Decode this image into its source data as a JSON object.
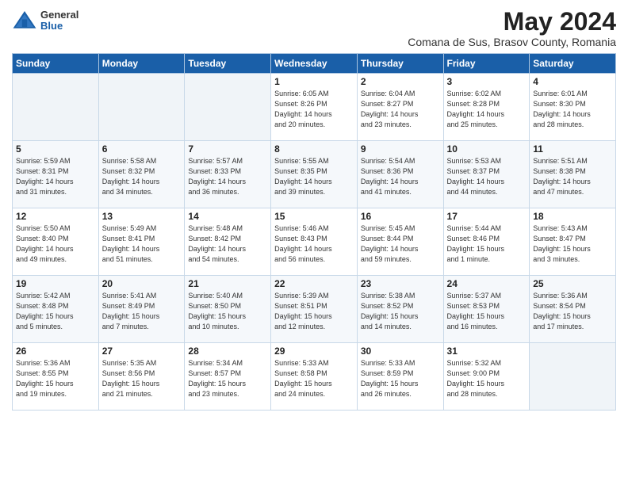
{
  "header": {
    "logo": {
      "general": "General",
      "blue": "Blue"
    },
    "title": "May 2024",
    "subtitle": "Comana de Sus, Brasov County, Romania"
  },
  "days_of_week": [
    "Sunday",
    "Monday",
    "Tuesday",
    "Wednesday",
    "Thursday",
    "Friday",
    "Saturday"
  ],
  "weeks": [
    [
      {
        "day": "",
        "info": ""
      },
      {
        "day": "",
        "info": ""
      },
      {
        "day": "",
        "info": ""
      },
      {
        "day": "1",
        "info": "Sunrise: 6:05 AM\nSunset: 8:26 PM\nDaylight: 14 hours\nand 20 minutes."
      },
      {
        "day": "2",
        "info": "Sunrise: 6:04 AM\nSunset: 8:27 PM\nDaylight: 14 hours\nand 23 minutes."
      },
      {
        "day": "3",
        "info": "Sunrise: 6:02 AM\nSunset: 8:28 PM\nDaylight: 14 hours\nand 25 minutes."
      },
      {
        "day": "4",
        "info": "Sunrise: 6:01 AM\nSunset: 8:30 PM\nDaylight: 14 hours\nand 28 minutes."
      }
    ],
    [
      {
        "day": "5",
        "info": "Sunrise: 5:59 AM\nSunset: 8:31 PM\nDaylight: 14 hours\nand 31 minutes."
      },
      {
        "day": "6",
        "info": "Sunrise: 5:58 AM\nSunset: 8:32 PM\nDaylight: 14 hours\nand 34 minutes."
      },
      {
        "day": "7",
        "info": "Sunrise: 5:57 AM\nSunset: 8:33 PM\nDaylight: 14 hours\nand 36 minutes."
      },
      {
        "day": "8",
        "info": "Sunrise: 5:55 AM\nSunset: 8:35 PM\nDaylight: 14 hours\nand 39 minutes."
      },
      {
        "day": "9",
        "info": "Sunrise: 5:54 AM\nSunset: 8:36 PM\nDaylight: 14 hours\nand 41 minutes."
      },
      {
        "day": "10",
        "info": "Sunrise: 5:53 AM\nSunset: 8:37 PM\nDaylight: 14 hours\nand 44 minutes."
      },
      {
        "day": "11",
        "info": "Sunrise: 5:51 AM\nSunset: 8:38 PM\nDaylight: 14 hours\nand 47 minutes."
      }
    ],
    [
      {
        "day": "12",
        "info": "Sunrise: 5:50 AM\nSunset: 8:40 PM\nDaylight: 14 hours\nand 49 minutes."
      },
      {
        "day": "13",
        "info": "Sunrise: 5:49 AM\nSunset: 8:41 PM\nDaylight: 14 hours\nand 51 minutes."
      },
      {
        "day": "14",
        "info": "Sunrise: 5:48 AM\nSunset: 8:42 PM\nDaylight: 14 hours\nand 54 minutes."
      },
      {
        "day": "15",
        "info": "Sunrise: 5:46 AM\nSunset: 8:43 PM\nDaylight: 14 hours\nand 56 minutes."
      },
      {
        "day": "16",
        "info": "Sunrise: 5:45 AM\nSunset: 8:44 PM\nDaylight: 14 hours\nand 59 minutes."
      },
      {
        "day": "17",
        "info": "Sunrise: 5:44 AM\nSunset: 8:46 PM\nDaylight: 15 hours\nand 1 minute."
      },
      {
        "day": "18",
        "info": "Sunrise: 5:43 AM\nSunset: 8:47 PM\nDaylight: 15 hours\nand 3 minutes."
      }
    ],
    [
      {
        "day": "19",
        "info": "Sunrise: 5:42 AM\nSunset: 8:48 PM\nDaylight: 15 hours\nand 5 minutes."
      },
      {
        "day": "20",
        "info": "Sunrise: 5:41 AM\nSunset: 8:49 PM\nDaylight: 15 hours\nand 7 minutes."
      },
      {
        "day": "21",
        "info": "Sunrise: 5:40 AM\nSunset: 8:50 PM\nDaylight: 15 hours\nand 10 minutes."
      },
      {
        "day": "22",
        "info": "Sunrise: 5:39 AM\nSunset: 8:51 PM\nDaylight: 15 hours\nand 12 minutes."
      },
      {
        "day": "23",
        "info": "Sunrise: 5:38 AM\nSunset: 8:52 PM\nDaylight: 15 hours\nand 14 minutes."
      },
      {
        "day": "24",
        "info": "Sunrise: 5:37 AM\nSunset: 8:53 PM\nDaylight: 15 hours\nand 16 minutes."
      },
      {
        "day": "25",
        "info": "Sunrise: 5:36 AM\nSunset: 8:54 PM\nDaylight: 15 hours\nand 17 minutes."
      }
    ],
    [
      {
        "day": "26",
        "info": "Sunrise: 5:36 AM\nSunset: 8:55 PM\nDaylight: 15 hours\nand 19 minutes."
      },
      {
        "day": "27",
        "info": "Sunrise: 5:35 AM\nSunset: 8:56 PM\nDaylight: 15 hours\nand 21 minutes."
      },
      {
        "day": "28",
        "info": "Sunrise: 5:34 AM\nSunset: 8:57 PM\nDaylight: 15 hours\nand 23 minutes."
      },
      {
        "day": "29",
        "info": "Sunrise: 5:33 AM\nSunset: 8:58 PM\nDaylight: 15 hours\nand 24 minutes."
      },
      {
        "day": "30",
        "info": "Sunrise: 5:33 AM\nSunset: 8:59 PM\nDaylight: 15 hours\nand 26 minutes."
      },
      {
        "day": "31",
        "info": "Sunrise: 5:32 AM\nSunset: 9:00 PM\nDaylight: 15 hours\nand 28 minutes."
      },
      {
        "day": "",
        "info": ""
      }
    ]
  ]
}
